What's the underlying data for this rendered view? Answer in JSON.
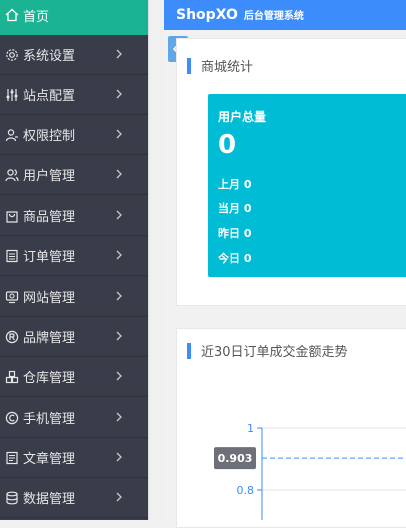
{
  "sidebar": {
    "items": [
      {
        "label": "首页",
        "icon": "home-icon",
        "active": true
      },
      {
        "label": "系统设置",
        "icon": "gear-icon"
      },
      {
        "label": "站点配置",
        "icon": "sliders-icon"
      },
      {
        "label": "权限控制",
        "icon": "user-key-icon"
      },
      {
        "label": "用户管理",
        "icon": "users-icon"
      },
      {
        "label": "商品管理",
        "icon": "shopping-bag-icon"
      },
      {
        "label": "订单管理",
        "icon": "order-list-icon"
      },
      {
        "label": "网站管理",
        "icon": "website-icon"
      },
      {
        "label": "品牌管理",
        "icon": "registered-icon"
      },
      {
        "label": "仓库管理",
        "icon": "warehouse-icon"
      },
      {
        "label": "手机管理",
        "icon": "copyright-icon"
      },
      {
        "label": "文章管理",
        "icon": "article-icon"
      },
      {
        "label": "数据管理",
        "icon": "database-icon"
      }
    ]
  },
  "header": {
    "brand": "ShopXO",
    "subtitle": "后台管理系统",
    "color": "#3c8dfb"
  },
  "store_stats": {
    "title": "商城统计",
    "user_total": {
      "title": "用户总量",
      "value": "0",
      "last_month": "上月 0",
      "this_month": "当月 0",
      "yesterday": "昨日 0",
      "today": "今日 0",
      "color": "#00bcd4"
    }
  },
  "order_trend": {
    "title": "近30日订单成交金额走势"
  },
  "chart_data": {
    "type": "line",
    "title": "",
    "xlabel": "",
    "ylabel": "",
    "y_ticks": [
      "1",
      "0.8"
    ],
    "ylim": [
      0.8,
      1
    ],
    "pointer_value": "0.903",
    "series": []
  }
}
